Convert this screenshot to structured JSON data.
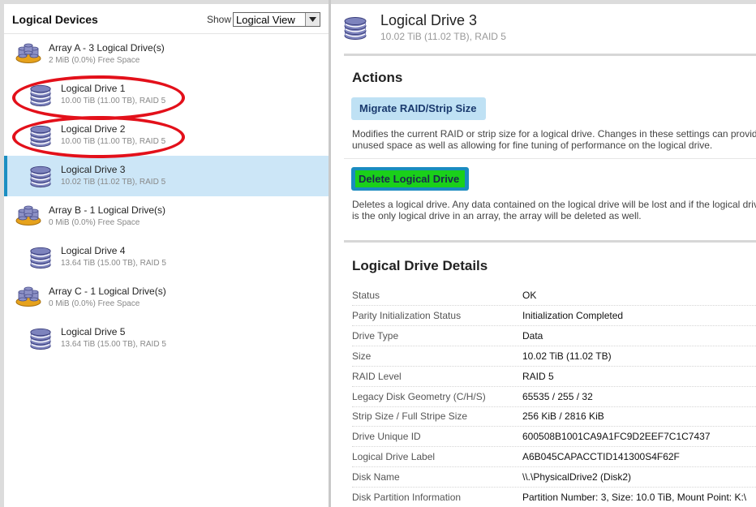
{
  "left_panel": {
    "title": "Logical Devices",
    "show_label": "Show",
    "view_select": {
      "value": "Logical View"
    },
    "items": [
      {
        "kind": "array",
        "title": "Array A - 3 Logical Drive(s)",
        "sub": "2 MiB (0.0%) Free Space",
        "selected": false,
        "circled": false
      },
      {
        "kind": "drive",
        "title": "Logical Drive 1",
        "sub": "10.00 TiB (11.00 TB), RAID 5",
        "selected": false,
        "circled": true
      },
      {
        "kind": "drive",
        "title": "Logical Drive 2",
        "sub": "10.00 TiB (11.00 TB), RAID 5",
        "selected": false,
        "circled": true
      },
      {
        "kind": "drive",
        "title": "Logical Drive 3",
        "sub": "10.02 TiB (11.02 TB), RAID 5",
        "selected": true,
        "circled": false
      },
      {
        "kind": "array",
        "title": "Array B - 1 Logical Drive(s)",
        "sub": "0 MiB (0.0%) Free Space",
        "selected": false,
        "circled": false
      },
      {
        "kind": "drive",
        "title": "Logical Drive 4",
        "sub": "13.64 TiB (15.00 TB), RAID 5",
        "selected": false,
        "circled": false
      },
      {
        "kind": "array",
        "title": "Array C - 1 Logical Drive(s)",
        "sub": "0 MiB (0.0%) Free Space",
        "selected": false,
        "circled": false
      },
      {
        "kind": "drive",
        "title": "Logical Drive 5",
        "sub": "13.64 TiB (15.00 TB), RAID 5",
        "selected": false,
        "circled": false
      }
    ]
  },
  "detail": {
    "title": "Logical Drive 3",
    "subtitle": "10.02 TiB (11.02 TB), RAID 5",
    "actions": {
      "heading": "Actions",
      "migrate_label": "Migrate RAID/Strip Size",
      "migrate_desc_1": "Modifies the current RAID or strip size for a logical drive. Changes in these settings can provid",
      "migrate_desc_2": "unused space as well as allowing for fine tuning of performance on the logical drive.",
      "delete_label": "Delete Logical Drive",
      "delete_desc_1": "Deletes a logical drive. Any data contained on the logical drive will be lost and if the logical driv",
      "delete_desc_2": "is the only logical drive in an array, the array will be deleted as well."
    },
    "details": {
      "heading": "Logical Drive Details",
      "rows": [
        {
          "label": "Status",
          "value": "OK"
        },
        {
          "label": "Parity Initialization Status",
          "value": "Initialization Completed"
        },
        {
          "label": "Drive Type",
          "value": "Data"
        },
        {
          "label": "Size",
          "value": "10.02 TiB (11.02 TB)"
        },
        {
          "label": "RAID Level",
          "value": "RAID 5"
        },
        {
          "label": "Legacy Disk Geometry (C/H/S)",
          "value": "65535 / 255 / 32"
        },
        {
          "label": "Strip Size / Full Stripe Size",
          "value": "256 KiB / 2816 KiB"
        },
        {
          "label": "Drive Unique ID",
          "value": "600508B1001CA9A1FC9D2EEF7C1C7437"
        },
        {
          "label": "Logical Drive Label",
          "value": "A6B045CAPACCTID141300S4F62F"
        },
        {
          "label": "Disk Name",
          "value": "\\\\.\\PhysicalDrive2 (Disk2)"
        },
        {
          "label": "Disk Partition Information",
          "value": "Partition Number: 3, Size: 10.0 TiB, Mount Point: K:\\"
        }
      ]
    }
  },
  "colors": {
    "selected_bg": "#cce6f7",
    "selected_bar": "#1c8fc2",
    "annotation_red": "#e3101a",
    "button_light": "#bfe1f4",
    "button_dark": "#1a8cc0",
    "highlight_green": "#1ad01a"
  },
  "icons": {
    "array": "array-disks-icon",
    "drive": "logical-drive-stack-icon",
    "dropdown": "chevron-down-icon"
  }
}
